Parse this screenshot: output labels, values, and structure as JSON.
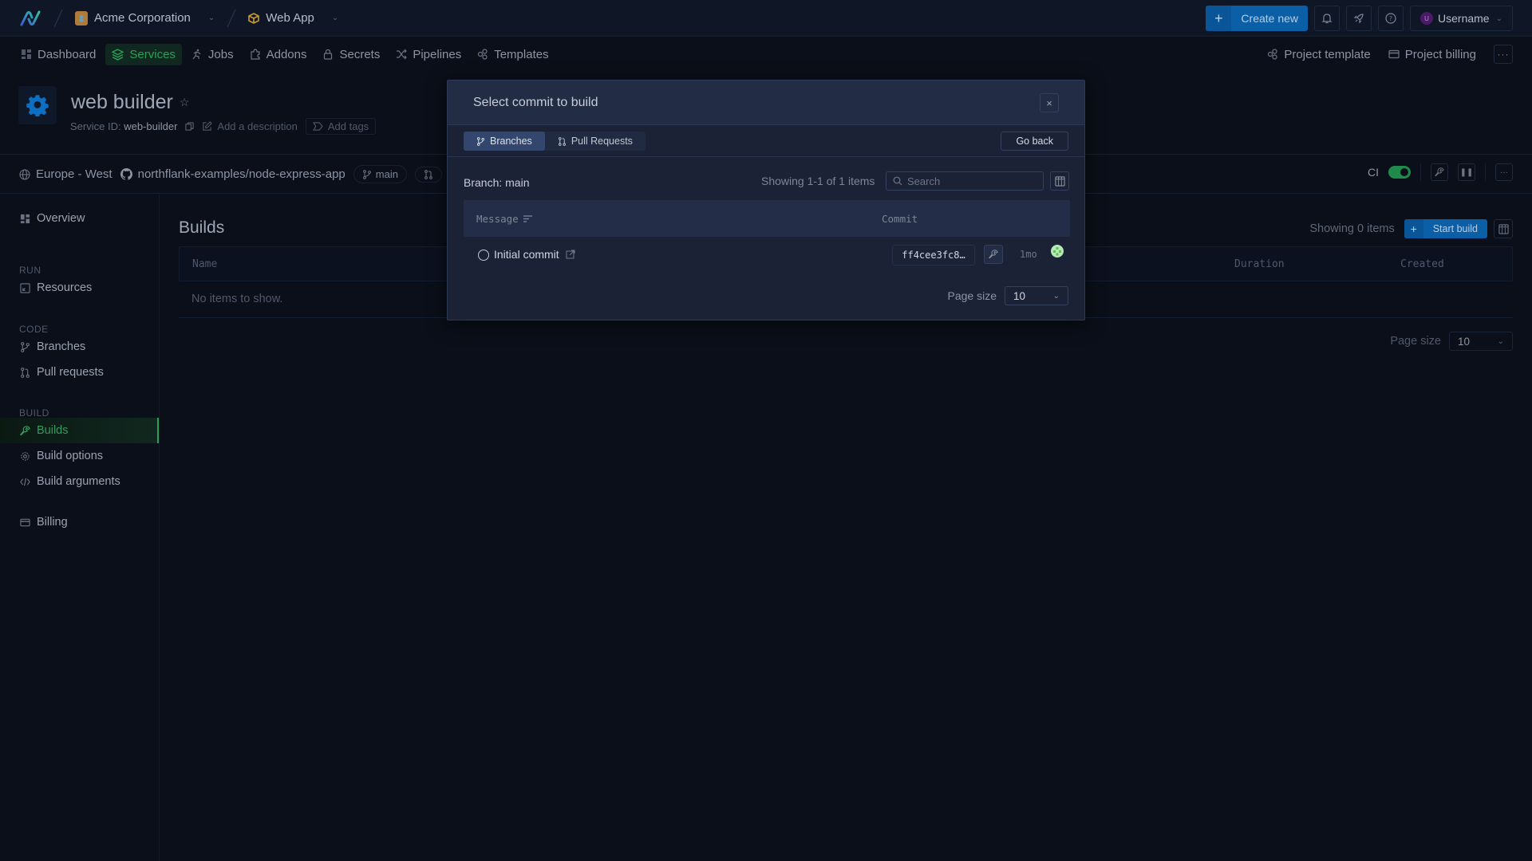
{
  "topbar": {
    "org": "Acme Corporation",
    "project": "Web App",
    "create_new": "Create new",
    "username": "Username",
    "user_initial": "U"
  },
  "nav": {
    "items": [
      {
        "label": "Dashboard",
        "icon": "dashboard-icon"
      },
      {
        "label": "Services",
        "icon": "layers-icon",
        "active": true
      },
      {
        "label": "Jobs",
        "icon": "runner-icon"
      },
      {
        "label": "Addons",
        "icon": "puzzle-icon"
      },
      {
        "label": "Secrets",
        "icon": "lock-icon"
      },
      {
        "label": "Pipelines",
        "icon": "shuffle-icon"
      },
      {
        "label": "Templates",
        "icon": "template-icon"
      }
    ],
    "project_template": "Project template",
    "project_billing": "Project billing"
  },
  "service": {
    "name": "web builder",
    "id_label": "Service ID:",
    "id_value": "web-builder",
    "add_description": "Add a description",
    "add_tags": "Add tags"
  },
  "info": {
    "region": "Europe - West",
    "repo": "northflank-examples/node-express-app",
    "branch": "main",
    "ci_label": "CI",
    "ci_enabled": true
  },
  "sidebar": {
    "overview": "Overview",
    "sections": {
      "run": "RUN",
      "code": "CODE",
      "build": "BUILD"
    },
    "resources": "Resources",
    "branches": "Branches",
    "pull_requests": "Pull requests",
    "builds": "Builds",
    "build_options": "Build options",
    "build_arguments": "Build arguments",
    "billing": "Billing"
  },
  "builds": {
    "title": "Builds",
    "showing": "Showing 0 items",
    "start_build": "Start build",
    "columns": {
      "name": "Name",
      "duration": "Duration",
      "created": "Created"
    },
    "empty": "No items to show.",
    "page_size_label": "Page size",
    "page_size": "10"
  },
  "modal": {
    "title": "Select commit to build",
    "close": "×",
    "tabs": [
      {
        "label": "Branches",
        "active": true
      },
      {
        "label": "Pull Requests",
        "active": false
      }
    ],
    "go_back": "Go back",
    "branch_label": "Branch: main",
    "showing": "Showing 1-1 of 1 items",
    "search_placeholder": "Search",
    "columns": {
      "message": "Message",
      "commit": "Commit"
    },
    "rows": [
      {
        "message": "Initial commit",
        "sha": "ff4cee3fc8…",
        "age": "1mo",
        "selected": false
      }
    ],
    "page_size_label": "Page size",
    "page_size": "10"
  },
  "colors": {
    "accent_green": "#2e9e5b",
    "primary_blue": "#0b5fa6",
    "modal_bg": "#1b2236"
  }
}
